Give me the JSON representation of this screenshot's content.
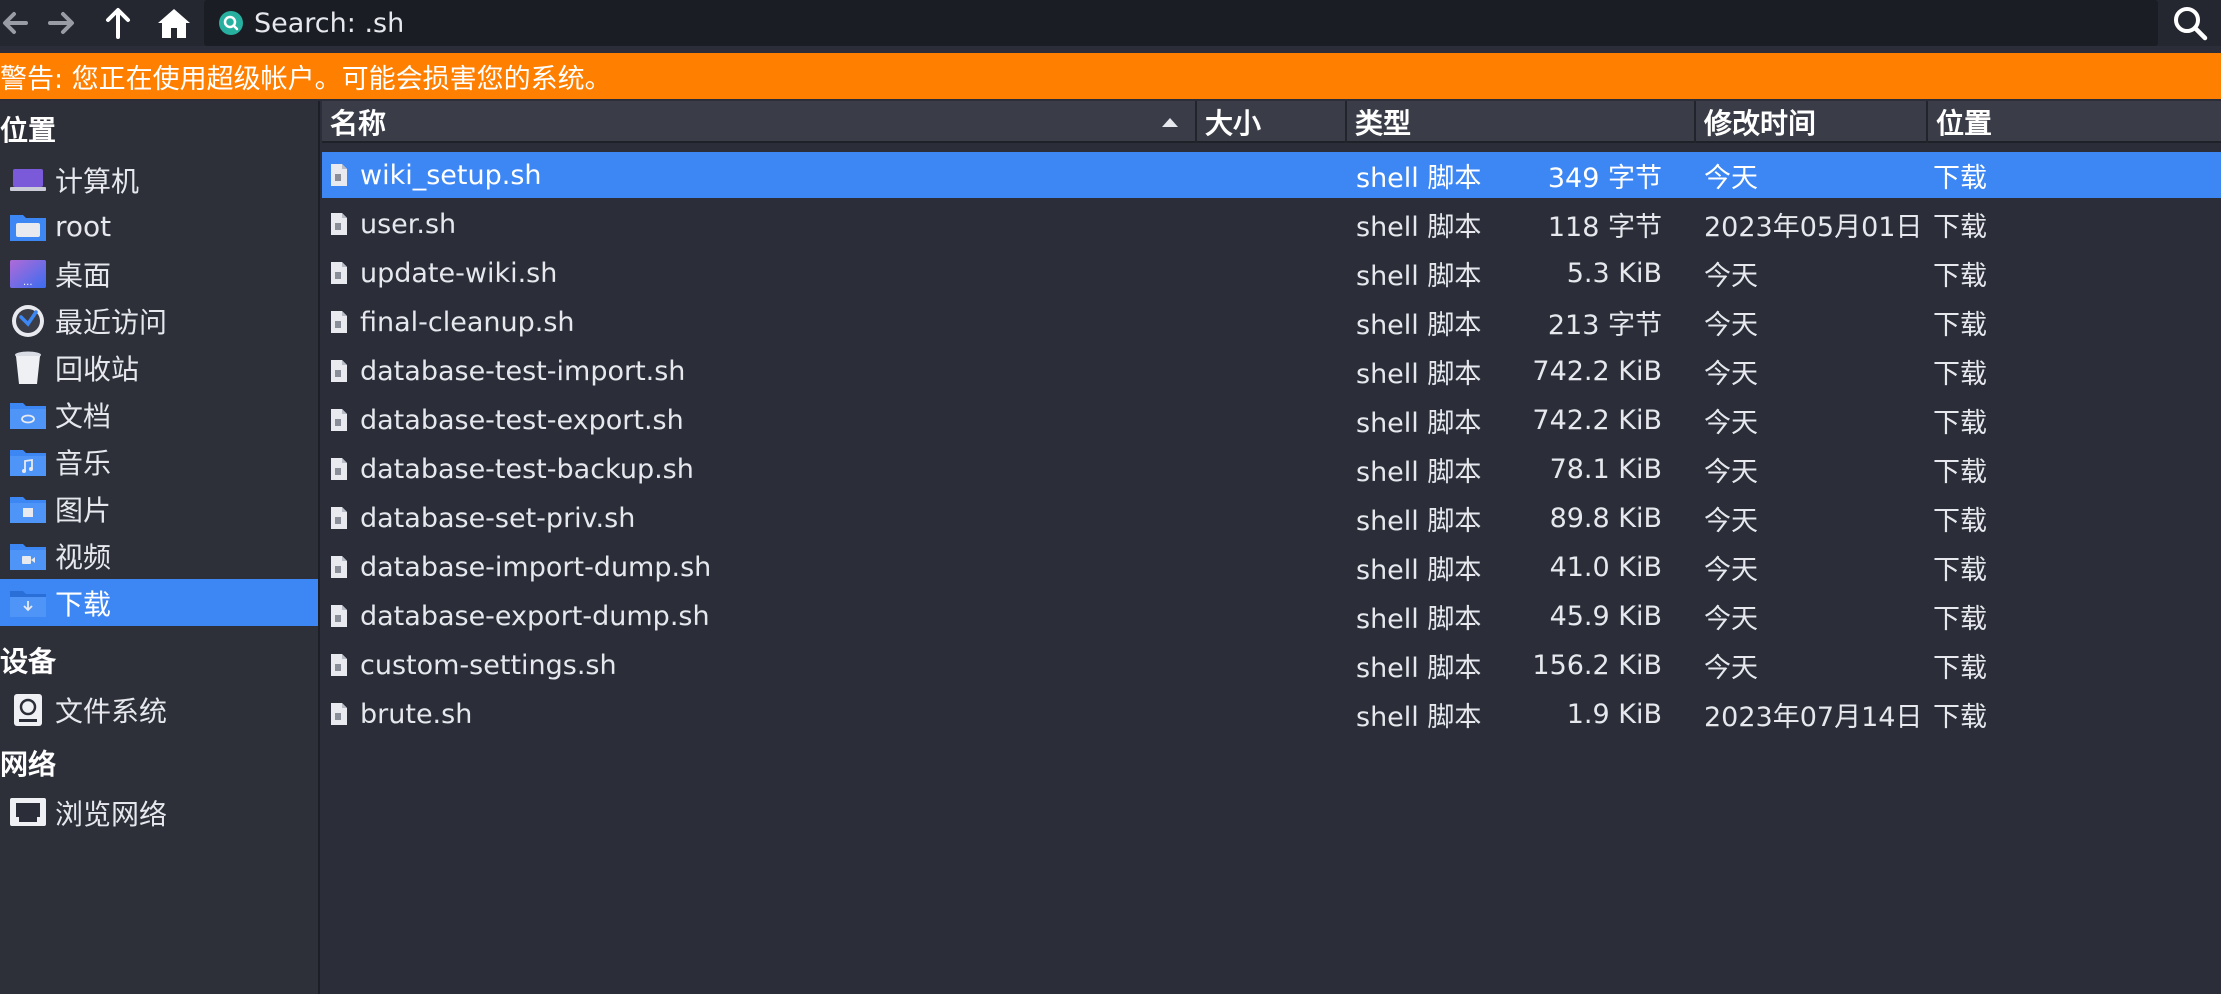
{
  "toolbar": {
    "search_text": "Search: .sh"
  },
  "warning": "警告: 您正在使用超级帐户。可能会损害您的系统。",
  "sidebar": {
    "places_header": "位置",
    "devices_header": "设备",
    "network_header": "网络",
    "places": [
      {
        "label": "计算机",
        "icon": "computer-icon"
      },
      {
        "label": "root",
        "icon": "home-folder-icon"
      },
      {
        "label": "桌面",
        "icon": "desktop-icon"
      },
      {
        "label": "最近访问",
        "icon": "recent-icon"
      },
      {
        "label": "回收站",
        "icon": "trash-icon"
      },
      {
        "label": "文档",
        "icon": "documents-folder-icon"
      },
      {
        "label": "音乐",
        "icon": "music-folder-icon"
      },
      {
        "label": "图片",
        "icon": "pictures-folder-icon"
      },
      {
        "label": "视频",
        "icon": "videos-folder-icon"
      },
      {
        "label": "下载",
        "icon": "downloads-folder-icon",
        "active": true
      }
    ],
    "devices": [
      {
        "label": "文件系统",
        "icon": "drive-icon"
      }
    ],
    "network": [
      {
        "label": "浏览网络",
        "icon": "network-icon"
      }
    ]
  },
  "columns": {
    "name": "名称",
    "size": "大小",
    "type": "类型",
    "modified": "修改时间",
    "location": "位置"
  },
  "files": [
    {
      "name": "wiki_setup.sh",
      "size": "349 字节",
      "type": "shell 脚本",
      "modified": "今天",
      "location": "下载",
      "selected": true
    },
    {
      "name": "user.sh",
      "size": "118 字节",
      "type": "shell 脚本",
      "modified": "2023年05月01日",
      "location": "下载"
    },
    {
      "name": "update-wiki.sh",
      "size": "5.3 KiB",
      "type": "shell 脚本",
      "modified": "今天",
      "location": "下载"
    },
    {
      "name": "final-cleanup.sh",
      "size": "213 字节",
      "type": "shell 脚本",
      "modified": "今天",
      "location": "下载"
    },
    {
      "name": "database-test-import.sh",
      "size": "742.2 KiB",
      "type": "shell 脚本",
      "modified": "今天",
      "location": "下载"
    },
    {
      "name": "database-test-export.sh",
      "size": "742.2 KiB",
      "type": "shell 脚本",
      "modified": "今天",
      "location": "下载"
    },
    {
      "name": "database-test-backup.sh",
      "size": "78.1 KiB",
      "type": "shell 脚本",
      "modified": "今天",
      "location": "下载"
    },
    {
      "name": "database-set-priv.sh",
      "size": "89.8 KiB",
      "type": "shell 脚本",
      "modified": "今天",
      "location": "下载"
    },
    {
      "name": "database-import-dump.sh",
      "size": "41.0 KiB",
      "type": "shell 脚本",
      "modified": "今天",
      "location": "下载"
    },
    {
      "name": "database-export-dump.sh",
      "size": "45.9 KiB",
      "type": "shell 脚本",
      "modified": "今天",
      "location": "下载"
    },
    {
      "name": "custom-settings.sh",
      "size": "156.2 KiB",
      "type": "shell 脚本",
      "modified": "今天",
      "location": "下载"
    },
    {
      "name": "brute.sh",
      "size": "1.9 KiB",
      "type": "shell 脚本",
      "modified": "2023年07月14日",
      "location": "下载"
    }
  ],
  "colors": {
    "warning_bg": "#ff7f00",
    "selection": "#3d87f5",
    "background": "#2b2e38"
  }
}
